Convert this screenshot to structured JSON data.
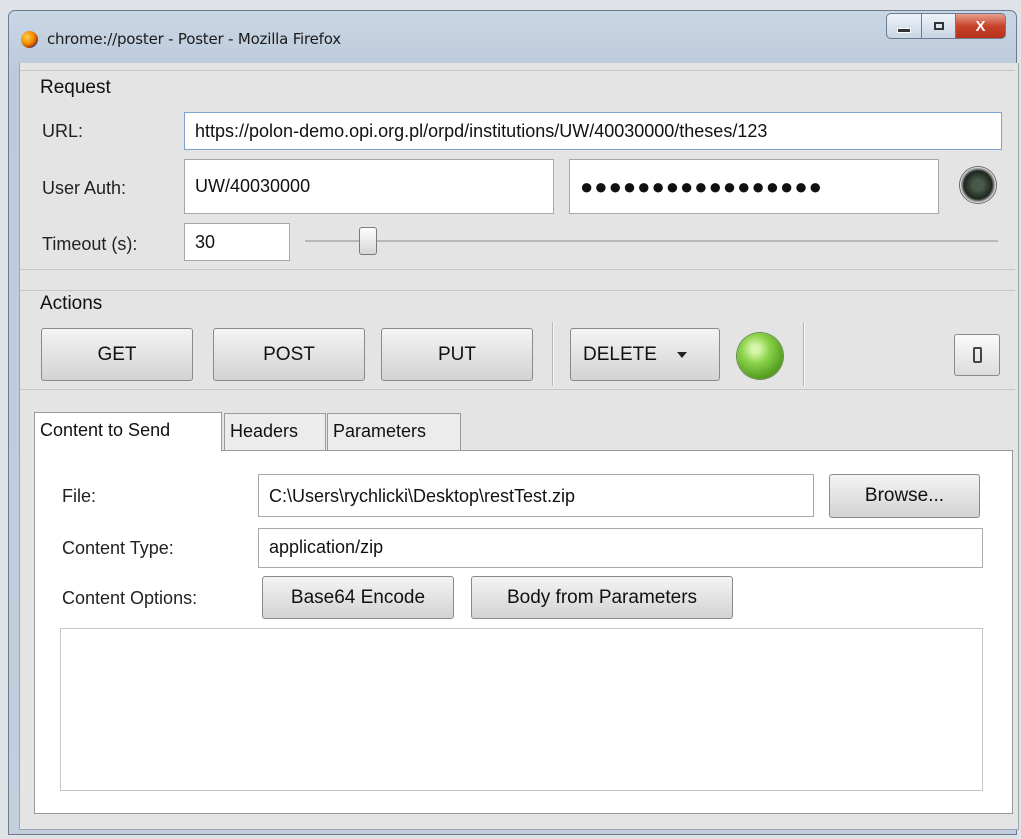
{
  "window": {
    "title": "chrome://poster - Poster - Mozilla Firefox",
    "close_glyph": "X"
  },
  "request": {
    "group_label": "Request",
    "url_label": "URL:",
    "url_value": "https://polon-demo.opi.org.pl/orpd/institutions/UW/40030000/theses/123",
    "user_auth_label": "User Auth:",
    "user_value": "UW/40030000",
    "password_mask": "●●●●●●●●●●●●●●●●●",
    "timeout_label": "Timeout (s):",
    "timeout_value": "30",
    "timeout_slider_fraction": 0.1
  },
  "actions": {
    "group_label": "Actions",
    "get_label": "GET",
    "post_label": "POST",
    "put_label": "PUT",
    "method_dropdown_value": "DELETE",
    "status_color": "#6fbf35"
  },
  "tabs": [
    {
      "label": "Content to Send",
      "active": true
    },
    {
      "label": "Headers",
      "active": false
    },
    {
      "label": "Parameters",
      "active": false
    }
  ],
  "content": {
    "file_label": "File:",
    "file_value": "C:\\Users\\rychlicki\\Desktop\\restTest.zip",
    "browse_label": "Browse...",
    "content_type_label": "Content Type:",
    "content_type_value": "application/zip",
    "content_options_label": "Content Options:",
    "base64_label": "Base64 Encode",
    "body_from_params_label": "Body from Parameters",
    "body_text": ""
  },
  "icons": {
    "app": "firefox-icon",
    "auth": "radar-icon",
    "status": "green-status-light-icon",
    "toggle": "toggle-switch-icon"
  }
}
